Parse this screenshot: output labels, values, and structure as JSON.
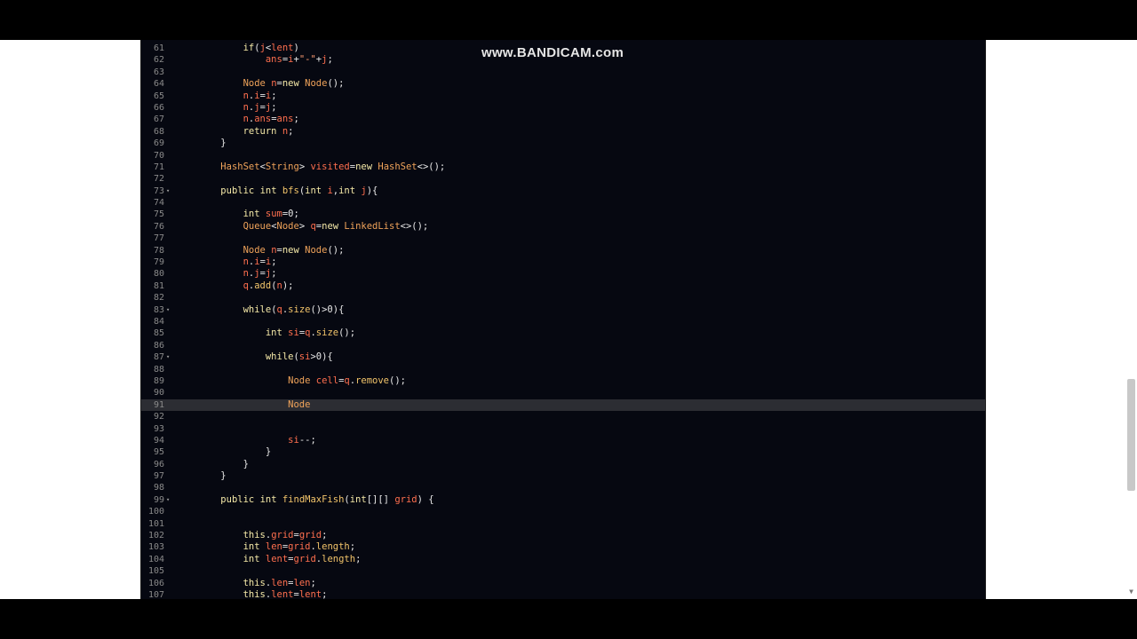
{
  "watermark": "www.BANDICAM.com",
  "active_line": 91,
  "colors": {
    "background": "#060811",
    "keyword": "#f5e9a8",
    "type": "#f0a35a",
    "variable": "#ff6f4e"
  },
  "lines": [
    {
      "n": "61",
      "fold": "",
      "code": "        if(j<lent)"
    },
    {
      "n": "62",
      "fold": "",
      "code": "            ans=i+\"-\"+j;"
    },
    {
      "n": "63",
      "fold": "",
      "code": ""
    },
    {
      "n": "64",
      "fold": "",
      "code": "        Node n=new Node();"
    },
    {
      "n": "65",
      "fold": "",
      "code": "        n.i=i;"
    },
    {
      "n": "66",
      "fold": "",
      "code": "        n.j=j;"
    },
    {
      "n": "67",
      "fold": "",
      "code": "        n.ans=ans;"
    },
    {
      "n": "68",
      "fold": "",
      "code": "        return n;"
    },
    {
      "n": "69",
      "fold": "",
      "code": "    }"
    },
    {
      "n": "70",
      "fold": "",
      "code": ""
    },
    {
      "n": "71",
      "fold": "",
      "code": "    HashSet<String> visited=new HashSet<>();"
    },
    {
      "n": "72",
      "fold": "",
      "code": ""
    },
    {
      "n": "73",
      "fold": "▾",
      "code": "    public int bfs(int i,int j){"
    },
    {
      "n": "74",
      "fold": "",
      "code": ""
    },
    {
      "n": "75",
      "fold": "",
      "code": "        int sum=0;"
    },
    {
      "n": "76",
      "fold": "",
      "code": "        Queue<Node> q=new LinkedList<>();"
    },
    {
      "n": "77",
      "fold": "",
      "code": ""
    },
    {
      "n": "78",
      "fold": "",
      "code": "        Node n=new Node();"
    },
    {
      "n": "79",
      "fold": "",
      "code": "        n.i=i;"
    },
    {
      "n": "80",
      "fold": "",
      "code": "        n.j=j;"
    },
    {
      "n": "81",
      "fold": "",
      "code": "        q.add(n);"
    },
    {
      "n": "82",
      "fold": "",
      "code": ""
    },
    {
      "n": "83",
      "fold": "▾",
      "code": "        while(q.size()>0){"
    },
    {
      "n": "84",
      "fold": "",
      "code": ""
    },
    {
      "n": "85",
      "fold": "",
      "code": "            int si=q.size();"
    },
    {
      "n": "86",
      "fold": "",
      "code": ""
    },
    {
      "n": "87",
      "fold": "▾",
      "code": "            while(si>0){"
    },
    {
      "n": "88",
      "fold": "",
      "code": ""
    },
    {
      "n": "89",
      "fold": "",
      "code": "                Node cell=q.remove();"
    },
    {
      "n": "90",
      "fold": "",
      "code": ""
    },
    {
      "n": "91",
      "fold": "",
      "code": "                Node"
    },
    {
      "n": "92",
      "fold": "",
      "code": ""
    },
    {
      "n": "93",
      "fold": "",
      "code": ""
    },
    {
      "n": "94",
      "fold": "",
      "code": "                si--;"
    },
    {
      "n": "95",
      "fold": "",
      "code": "            }"
    },
    {
      "n": "96",
      "fold": "",
      "code": "        }"
    },
    {
      "n": "97",
      "fold": "",
      "code": "    }"
    },
    {
      "n": "98",
      "fold": "",
      "code": ""
    },
    {
      "n": "99",
      "fold": "▾",
      "code": "    public int findMaxFish(int[][] grid) {"
    },
    {
      "n": "100",
      "fold": "",
      "code": ""
    },
    {
      "n": "101",
      "fold": "",
      "code": ""
    },
    {
      "n": "102",
      "fold": "",
      "code": "        this.grid=grid;"
    },
    {
      "n": "103",
      "fold": "",
      "code": "        int len=grid.length;"
    },
    {
      "n": "104",
      "fold": "",
      "code": "        int lent=grid.length;"
    },
    {
      "n": "105",
      "fold": "",
      "code": ""
    },
    {
      "n": "106",
      "fold": "",
      "code": "        this.len=len;"
    },
    {
      "n": "107",
      "fold": "",
      "code": "        this.lent=lent;"
    }
  ]
}
